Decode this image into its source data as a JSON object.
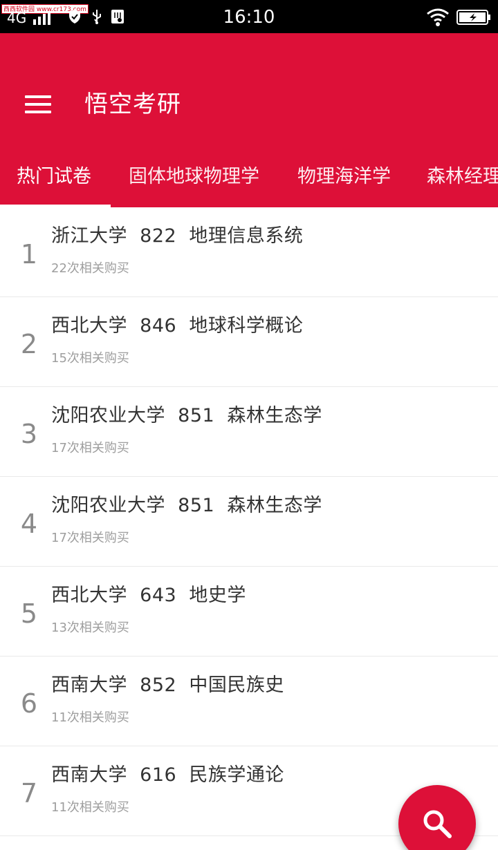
{
  "status_bar": {
    "watermark": "西西软件园 www.cr173.com",
    "network": "4G",
    "time": "16:10"
  },
  "app_bar": {
    "title": "悟空考研",
    "menu_icon": "menu-icon"
  },
  "tabs": [
    {
      "label": "热门试卷",
      "active": true
    },
    {
      "label": "固体地球物理学",
      "active": false
    },
    {
      "label": "物理海洋学",
      "active": false
    },
    {
      "label": "森林经理学",
      "active": false
    }
  ],
  "list": [
    {
      "rank": "1",
      "title": "浙江大学  822  地理信息系统",
      "subtitle": "22次相关购买"
    },
    {
      "rank": "2",
      "title": "西北大学  846  地球科学概论",
      "subtitle": "15次相关购买"
    },
    {
      "rank": "3",
      "title": "沈阳农业大学  851  森林生态学",
      "subtitle": "17次相关购买"
    },
    {
      "rank": "4",
      "title": "沈阳农业大学  851  森林生态学",
      "subtitle": "17次相关购买"
    },
    {
      "rank": "5",
      "title": "西北大学  643  地史学",
      "subtitle": "13次相关购买"
    },
    {
      "rank": "6",
      "title": "西南大学  852  中国民族史",
      "subtitle": "11次相关购买"
    },
    {
      "rank": "7",
      "title": "西南大学  616  民族学通论",
      "subtitle": "11次相关购买"
    }
  ],
  "fab": {
    "icon": "search-icon"
  },
  "colors": {
    "primary": "#dd1038",
    "text": "#333333",
    "subtext": "#9e9e9e",
    "rank": "#8a8a8a"
  }
}
